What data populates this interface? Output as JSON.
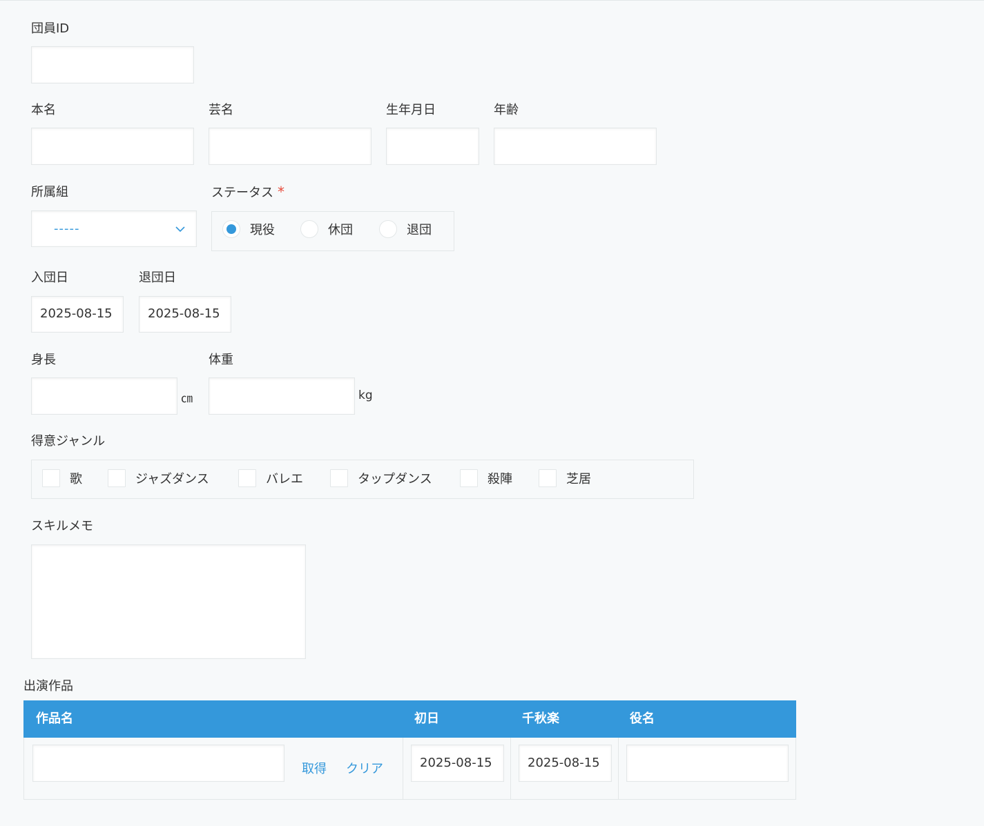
{
  "fields": {
    "member_id": {
      "label": "団員ID",
      "value": ""
    },
    "real_name": {
      "label": "本名",
      "value": ""
    },
    "stage_name": {
      "label": "芸名",
      "value": ""
    },
    "birth_date": {
      "label": "生年月日",
      "value": ""
    },
    "age": {
      "label": "年齢",
      "value": ""
    },
    "troupe": {
      "label": "所属組",
      "selected": "-----"
    },
    "status": {
      "label": "ステータス",
      "required_mark": "*",
      "options": [
        {
          "label": "現役",
          "checked": true
        },
        {
          "label": "休団",
          "checked": false
        },
        {
          "label": "退団",
          "checked": false
        }
      ]
    },
    "join_date": {
      "label": "入団日",
      "value": "2025-08-15"
    },
    "leave_date": {
      "label": "退団日",
      "value": "2025-08-15"
    },
    "height": {
      "label": "身長",
      "value": "",
      "unit": "㎝"
    },
    "weight": {
      "label": "体重",
      "value": "",
      "unit": "kg"
    },
    "genres": {
      "label": "得意ジャンル",
      "options": [
        {
          "label": "歌",
          "checked": false
        },
        {
          "label": "ジャズダンス",
          "checked": false
        },
        {
          "label": "バレエ",
          "checked": false
        },
        {
          "label": "タップダンス",
          "checked": false
        },
        {
          "label": "殺陣",
          "checked": false
        },
        {
          "label": "芝居",
          "checked": false
        }
      ]
    },
    "skill_memo": {
      "label": "スキルメモ",
      "value": ""
    }
  },
  "performances": {
    "label": "出演作品",
    "columns": [
      "作品名",
      "初日",
      "千秋楽",
      "役名"
    ],
    "rows": [
      {
        "title": "",
        "fetch_label": "取得",
        "clear_label": "クリア",
        "opening": "2025-08-15",
        "closing": "2025-08-15",
        "role": ""
      }
    ]
  }
}
